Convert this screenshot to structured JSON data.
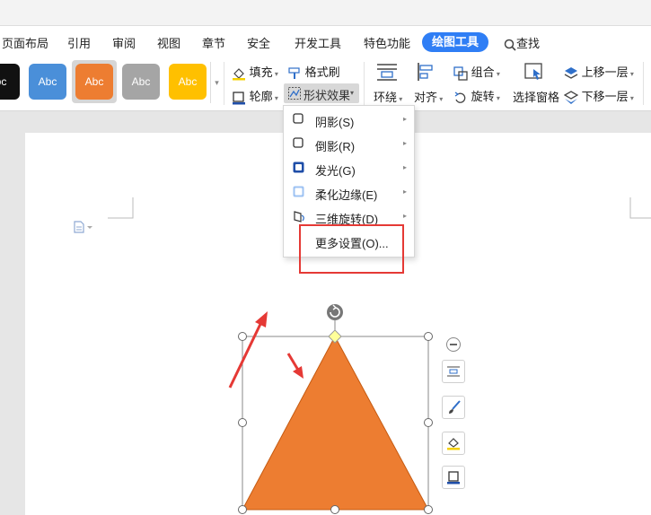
{
  "tabs": {
    "page_layout": "页面布局",
    "references": "引用",
    "review": "审阅",
    "view": "视图",
    "sections": "章节",
    "security": "安全",
    "developer": "开发工具",
    "special": "特色功能",
    "drawing_tools": "绘图工具",
    "find": "查找"
  },
  "ribbon": {
    "style_swatches": [
      {
        "label": "bc",
        "color": "#111111"
      },
      {
        "label": "Abc",
        "color": "#4a8fd9"
      },
      {
        "label": "Abc",
        "color": "#ed7d31"
      },
      {
        "label": "Abc",
        "color": "#a5a5a5"
      },
      {
        "label": "Abc",
        "color": "#ffc000"
      }
    ],
    "fill": "填充",
    "format_painter": "格式刷",
    "outline": "轮廓",
    "shape_effects": "形状效果",
    "wrap": "环绕",
    "align": "对齐",
    "group": "组合",
    "rotate": "旋转",
    "selection_pane": "选择窗格",
    "bring_forward": "上移一层",
    "send_backward": "下移一层"
  },
  "effects_menu": {
    "items": [
      {
        "label": "阴影(S)",
        "icon": "shadow-icon",
        "submenu": true
      },
      {
        "label": "倒影(R)",
        "icon": "reflection-icon",
        "submenu": true
      },
      {
        "label": "发光(G)",
        "icon": "glow-icon",
        "submenu": true
      },
      {
        "label": "柔化边缘(E)",
        "icon": "soft-edges-icon",
        "submenu": true
      },
      {
        "label": "三维旋转(D)",
        "icon": "3d-rotation-icon",
        "submenu": true
      },
      {
        "label": "更多设置(O)...",
        "icon": "",
        "submenu": false
      }
    ]
  },
  "colors": {
    "accent": "#2f7ef5",
    "shape_fill": "#ed7d31",
    "annotation_red": "#e53935"
  }
}
